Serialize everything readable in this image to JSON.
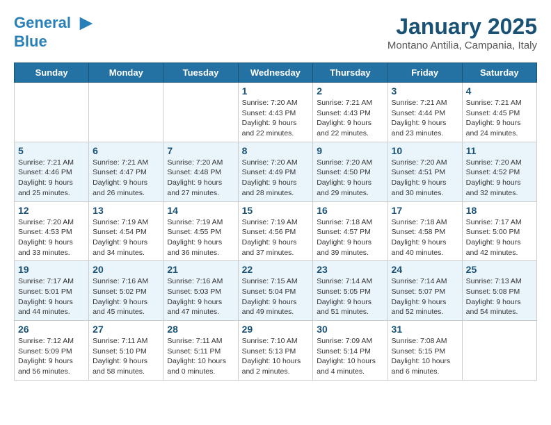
{
  "header": {
    "logo_line1": "General",
    "logo_line2": "Blue",
    "month": "January 2025",
    "location": "Montano Antilia, Campania, Italy"
  },
  "days_of_week": [
    "Sunday",
    "Monday",
    "Tuesday",
    "Wednesday",
    "Thursday",
    "Friday",
    "Saturday"
  ],
  "weeks": [
    [
      {
        "day": null
      },
      {
        "day": null
      },
      {
        "day": null
      },
      {
        "day": "1",
        "sunrise": "Sunrise: 7:20 AM",
        "sunset": "Sunset: 4:43 PM",
        "daylight": "Daylight: 9 hours and 22 minutes."
      },
      {
        "day": "2",
        "sunrise": "Sunrise: 7:21 AM",
        "sunset": "Sunset: 4:43 PM",
        "daylight": "Daylight: 9 hours and 22 minutes."
      },
      {
        "day": "3",
        "sunrise": "Sunrise: 7:21 AM",
        "sunset": "Sunset: 4:44 PM",
        "daylight": "Daylight: 9 hours and 23 minutes."
      },
      {
        "day": "4",
        "sunrise": "Sunrise: 7:21 AM",
        "sunset": "Sunset: 4:45 PM",
        "daylight": "Daylight: 9 hours and 24 minutes."
      }
    ],
    [
      {
        "day": "5",
        "sunrise": "Sunrise: 7:21 AM",
        "sunset": "Sunset: 4:46 PM",
        "daylight": "Daylight: 9 hours and 25 minutes."
      },
      {
        "day": "6",
        "sunrise": "Sunrise: 7:21 AM",
        "sunset": "Sunset: 4:47 PM",
        "daylight": "Daylight: 9 hours and 26 minutes."
      },
      {
        "day": "7",
        "sunrise": "Sunrise: 7:20 AM",
        "sunset": "Sunset: 4:48 PM",
        "daylight": "Daylight: 9 hours and 27 minutes."
      },
      {
        "day": "8",
        "sunrise": "Sunrise: 7:20 AM",
        "sunset": "Sunset: 4:49 PM",
        "daylight": "Daylight: 9 hours and 28 minutes."
      },
      {
        "day": "9",
        "sunrise": "Sunrise: 7:20 AM",
        "sunset": "Sunset: 4:50 PM",
        "daylight": "Daylight: 9 hours and 29 minutes."
      },
      {
        "day": "10",
        "sunrise": "Sunrise: 7:20 AM",
        "sunset": "Sunset: 4:51 PM",
        "daylight": "Daylight: 9 hours and 30 minutes."
      },
      {
        "day": "11",
        "sunrise": "Sunrise: 7:20 AM",
        "sunset": "Sunset: 4:52 PM",
        "daylight": "Daylight: 9 hours and 32 minutes."
      }
    ],
    [
      {
        "day": "12",
        "sunrise": "Sunrise: 7:20 AM",
        "sunset": "Sunset: 4:53 PM",
        "daylight": "Daylight: 9 hours and 33 minutes."
      },
      {
        "day": "13",
        "sunrise": "Sunrise: 7:19 AM",
        "sunset": "Sunset: 4:54 PM",
        "daylight": "Daylight: 9 hours and 34 minutes."
      },
      {
        "day": "14",
        "sunrise": "Sunrise: 7:19 AM",
        "sunset": "Sunset: 4:55 PM",
        "daylight": "Daylight: 9 hours and 36 minutes."
      },
      {
        "day": "15",
        "sunrise": "Sunrise: 7:19 AM",
        "sunset": "Sunset: 4:56 PM",
        "daylight": "Daylight: 9 hours and 37 minutes."
      },
      {
        "day": "16",
        "sunrise": "Sunrise: 7:18 AM",
        "sunset": "Sunset: 4:57 PM",
        "daylight": "Daylight: 9 hours and 39 minutes."
      },
      {
        "day": "17",
        "sunrise": "Sunrise: 7:18 AM",
        "sunset": "Sunset: 4:58 PM",
        "daylight": "Daylight: 9 hours and 40 minutes."
      },
      {
        "day": "18",
        "sunrise": "Sunrise: 7:17 AM",
        "sunset": "Sunset: 5:00 PM",
        "daylight": "Daylight: 9 hours and 42 minutes."
      }
    ],
    [
      {
        "day": "19",
        "sunrise": "Sunrise: 7:17 AM",
        "sunset": "Sunset: 5:01 PM",
        "daylight": "Daylight: 9 hours and 44 minutes."
      },
      {
        "day": "20",
        "sunrise": "Sunrise: 7:16 AM",
        "sunset": "Sunset: 5:02 PM",
        "daylight": "Daylight: 9 hours and 45 minutes."
      },
      {
        "day": "21",
        "sunrise": "Sunrise: 7:16 AM",
        "sunset": "Sunset: 5:03 PM",
        "daylight": "Daylight: 9 hours and 47 minutes."
      },
      {
        "day": "22",
        "sunrise": "Sunrise: 7:15 AM",
        "sunset": "Sunset: 5:04 PM",
        "daylight": "Daylight: 9 hours and 49 minutes."
      },
      {
        "day": "23",
        "sunrise": "Sunrise: 7:14 AM",
        "sunset": "Sunset: 5:05 PM",
        "daylight": "Daylight: 9 hours and 51 minutes."
      },
      {
        "day": "24",
        "sunrise": "Sunrise: 7:14 AM",
        "sunset": "Sunset: 5:07 PM",
        "daylight": "Daylight: 9 hours and 52 minutes."
      },
      {
        "day": "25",
        "sunrise": "Sunrise: 7:13 AM",
        "sunset": "Sunset: 5:08 PM",
        "daylight": "Daylight: 9 hours and 54 minutes."
      }
    ],
    [
      {
        "day": "26",
        "sunrise": "Sunrise: 7:12 AM",
        "sunset": "Sunset: 5:09 PM",
        "daylight": "Daylight: 9 hours and 56 minutes."
      },
      {
        "day": "27",
        "sunrise": "Sunrise: 7:11 AM",
        "sunset": "Sunset: 5:10 PM",
        "daylight": "Daylight: 9 hours and 58 minutes."
      },
      {
        "day": "28",
        "sunrise": "Sunrise: 7:11 AM",
        "sunset": "Sunset: 5:11 PM",
        "daylight": "Daylight: 10 hours and 0 minutes."
      },
      {
        "day": "29",
        "sunrise": "Sunrise: 7:10 AM",
        "sunset": "Sunset: 5:13 PM",
        "daylight": "Daylight: 10 hours and 2 minutes."
      },
      {
        "day": "30",
        "sunrise": "Sunrise: 7:09 AM",
        "sunset": "Sunset: 5:14 PM",
        "daylight": "Daylight: 10 hours and 4 minutes."
      },
      {
        "day": "31",
        "sunrise": "Sunrise: 7:08 AM",
        "sunset": "Sunset: 5:15 PM",
        "daylight": "Daylight: 10 hours and 6 minutes."
      },
      {
        "day": null
      }
    ]
  ]
}
